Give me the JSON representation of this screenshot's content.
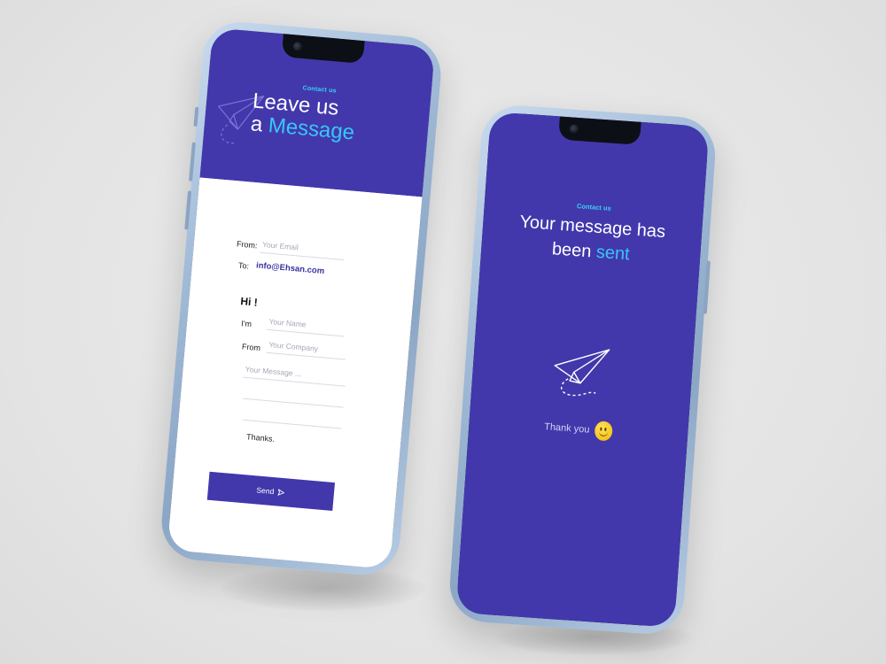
{
  "form_screen": {
    "eyebrow": "Contact us",
    "title_line1": "Leave us",
    "title_line2_prefix": "a",
    "title_line2_accent": "Message",
    "from_label": "From:",
    "email_placeholder": "Your Email",
    "to_label": "To:",
    "to_value": "info@Ehsan.com",
    "greeting": "Hi !",
    "im_label": "I'm",
    "name_placeholder": "Your Name",
    "company_from_label": "From",
    "company_placeholder": "Your Company",
    "message_placeholder": "Your Message ...",
    "signoff": "Thanks.",
    "send_label": "Send"
  },
  "sent_screen": {
    "eyebrow": "Contact us",
    "title_line1": "Your message has",
    "title_line2_prefix": "been",
    "title_line2_accent": "sent",
    "thank_you": "Thank you"
  },
  "colors": {
    "brand": "#4238ac",
    "accent": "#39c6f4",
    "background": "#e6e6e6"
  },
  "icons": [
    "paper-plane-icon",
    "send-arrow-icon",
    "smiley-icon"
  ]
}
